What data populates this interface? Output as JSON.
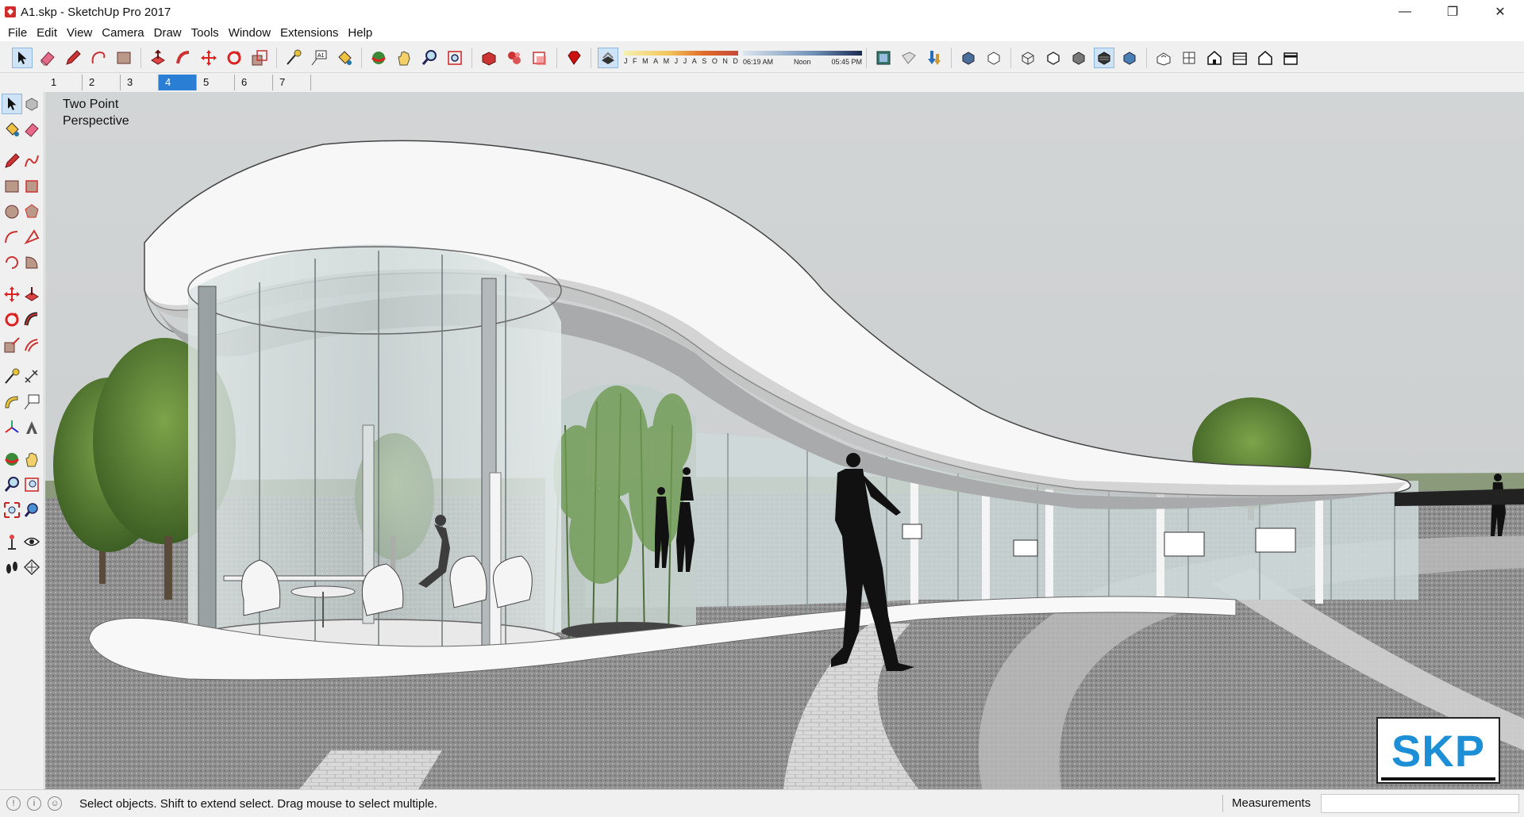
{
  "window": {
    "title": "A1.skp - SketchUp Pro 2017",
    "minimize_glyph": "—",
    "maximize_glyph": "❐",
    "close_glyph": "✕"
  },
  "menu": [
    "File",
    "Edit",
    "View",
    "Camera",
    "Draw",
    "Tools",
    "Window",
    "Extensions",
    "Help"
  ],
  "toolbar": {
    "icons": [
      "select-icon",
      "eraser-icon",
      "pencil-icon",
      "lasso-icon",
      "rectangle-icon",
      "push-pull-icon",
      "follow-me-icon",
      "move-icon",
      "rotate-icon",
      "scale-icon",
      "tape-measure-icon",
      "text-icon",
      "paint-bucket-icon",
      "orbit-icon",
      "pan-icon",
      "zoom-icon",
      "zoom-extents-icon",
      "3d-warehouse-icon",
      "extension-warehouse-icon",
      "layout-icon",
      "ruby-icon"
    ],
    "shadow_months": [
      "J",
      "F",
      "M",
      "A",
      "M",
      "J",
      "J",
      "A",
      "S",
      "O",
      "N",
      "D"
    ],
    "shadow_time_start": "06:19 AM",
    "shadow_time_mid": "Noon",
    "shadow_time_end": "05:45 PM",
    "view_icons": [
      "xray-icon",
      "back-edges-icon",
      "wireframe-icon",
      "hidden-line-icon",
      "shaded-icon",
      "shaded-textures-icon",
      "monochrome-icon",
      "iso-view-icon",
      "top-view-icon",
      "front-view-icon",
      "right-view-icon",
      "back-view-icon",
      "left-view-icon"
    ]
  },
  "scenes": {
    "tabs": [
      "1",
      "2",
      "3",
      "4",
      "5",
      "6",
      "7"
    ],
    "selected": "4"
  },
  "left_tools": [
    [
      "select-icon",
      "component-icon"
    ],
    [
      "paint-bucket-icon",
      "eraser-icon"
    ],
    [
      "pencil-icon",
      "freehand-icon"
    ],
    [
      "rectangle-icon",
      "rotated-rectangle-icon"
    ],
    [
      "circle-icon",
      "polygon-icon"
    ],
    [
      "arc-icon",
      "two-point-arc-icon"
    ],
    [
      "three-point-arc-icon",
      "pie-icon"
    ],
    [
      "move-icon",
      "push-pull-icon"
    ],
    [
      "rotate-icon",
      "follow-me-icon"
    ],
    [
      "scale-icon",
      "offset-icon"
    ],
    [
      "tape-measure-icon",
      "dimension-icon"
    ],
    [
      "protractor-icon",
      "text-icon"
    ],
    [
      "axes-icon",
      "3d-text-icon"
    ],
    [
      "orbit-icon",
      "pan-icon"
    ],
    [
      "zoom-icon",
      "zoom-window-icon"
    ],
    [
      "zoom-extents-icon",
      "previous-view-icon"
    ],
    [
      "position-camera-icon",
      "look-around-icon"
    ],
    [
      "walk-icon",
      "section-plane-icon"
    ]
  ],
  "viewport": {
    "camera_label": "Two Point\nPerspective",
    "logo_text": "SKP"
  },
  "status": {
    "message": "Select objects. Shift to extend select. Drag mouse to select multiple.",
    "measurements_label": "Measurements",
    "measurements_value": ""
  },
  "colors": {
    "accent": "#2a7fd4",
    "logo_blue": "#1d8fd6",
    "sky": "#cfd2d3"
  }
}
